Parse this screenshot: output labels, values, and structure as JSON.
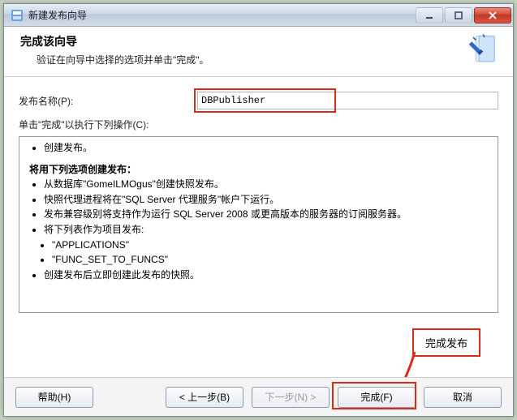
{
  "window": {
    "title": "新建发布向导",
    "buttons": {
      "min": "—",
      "max": "□",
      "close": "X"
    }
  },
  "header": {
    "title": "完成该向导",
    "subtitle": "验证在向导中选择的选项并单击\"完成\"。"
  },
  "form": {
    "publish_name_label": "发布名称(P):",
    "publish_name_value": "DBPublisher",
    "below_label": "单击\"完成\"以执行下列操作(C):"
  },
  "summary": {
    "line1": "创建发布。",
    "section_title": "将用下列选项创建发布：",
    "items": [
      "从数据库\"GomeILMOgus\"创建快照发布。",
      "快照代理进程将在\"SQL Server 代理服务\"帐户下运行。",
      "发布兼容级别将支持作为运行 SQL Server 2008 或更高版本的服务器的订阅服务器。",
      "将下列表作为项目发布:"
    ],
    "nested_items": [
      "\"APPLICATIONS\"",
      "\"FUNC_SET_TO_FUNCS\""
    ],
    "last_item": "创建发布后立即创建此发布的快照。"
  },
  "callout": {
    "text": "完成发布"
  },
  "buttons": {
    "help": "帮助(H)",
    "back": "< 上一步(B)",
    "next": "下一步(N) >",
    "finish": "完成(F)",
    "cancel": "取消"
  }
}
